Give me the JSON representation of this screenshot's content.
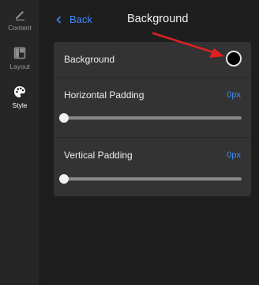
{
  "rail": {
    "items": [
      {
        "label": "Content",
        "icon": "pencil-icon"
      },
      {
        "label": "Layout",
        "icon": "layout-icon"
      },
      {
        "label": "Style",
        "icon": "palette-icon"
      }
    ],
    "active": "Style"
  },
  "header": {
    "back_label": "Back",
    "title": "Background"
  },
  "settings": {
    "background": {
      "label": "Background",
      "color": "#000000"
    },
    "horizontal_padding": {
      "label": "Horizontal Padding",
      "value_text": "0px",
      "value": 0
    },
    "vertical_padding": {
      "label": "Vertical Padding",
      "value_text": "0px",
      "value": 0
    }
  },
  "colors": {
    "accent": "#3b8bff",
    "annotation_arrow": "#e02020"
  }
}
